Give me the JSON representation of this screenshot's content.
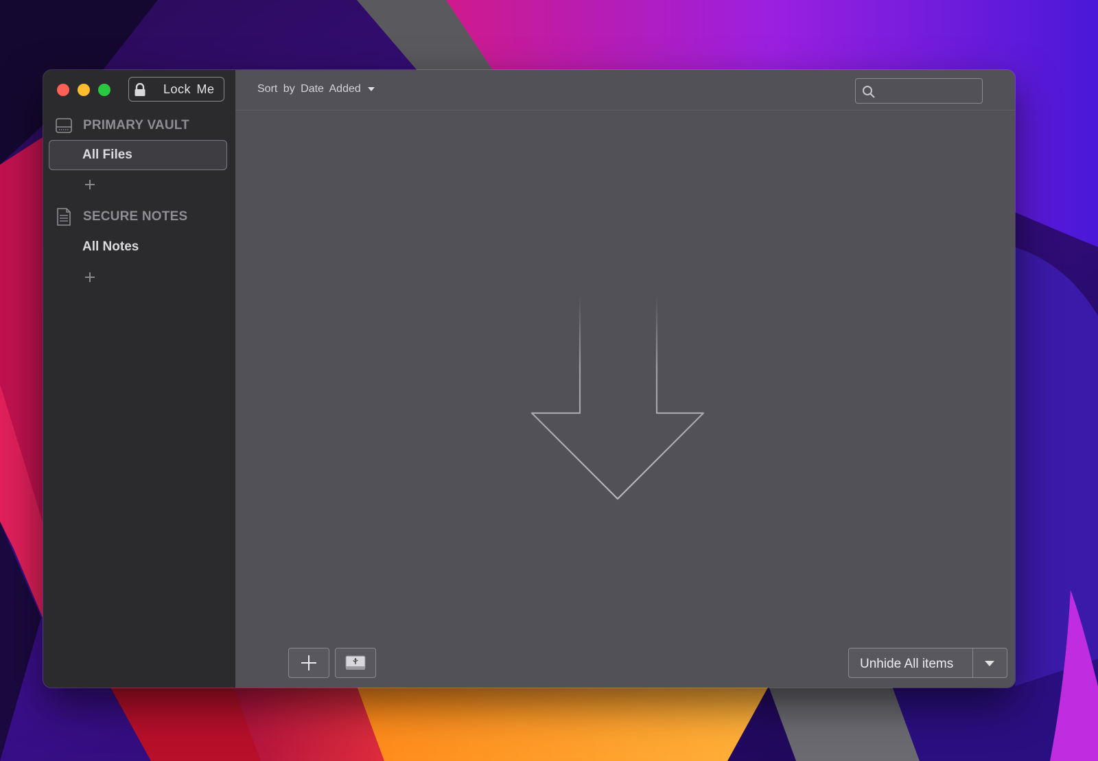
{
  "window": {
    "lock_button_label": "Lock  Me"
  },
  "sidebar": {
    "sections": [
      {
        "title": "PRIMARY VAULT",
        "icon": "drive-icon",
        "items": [
          {
            "label": "All Files",
            "selected": true
          }
        ]
      },
      {
        "title": "SECURE NOTES",
        "icon": "note-document-icon",
        "items": [
          {
            "label": "All Notes",
            "selected": false
          }
        ]
      }
    ]
  },
  "toolbar": {
    "sort_label": "Sort  by  Date  Added",
    "search_placeholder": ""
  },
  "main": {
    "drop_zone_icon": "down-arrow-outline-icon"
  },
  "bottom_bar": {
    "add_icon": "plus-icon",
    "usb_icon": "usb-drive-icon",
    "unhide_label": "Unhide All items",
    "unhide_menu_icon": "chevron-down-icon"
  },
  "colors": {
    "sidebar_bg": "#2b2b2e",
    "main_bg": "#515157",
    "close": "#fe5f57",
    "minimize": "#febc2e",
    "maximize": "#28c840"
  }
}
